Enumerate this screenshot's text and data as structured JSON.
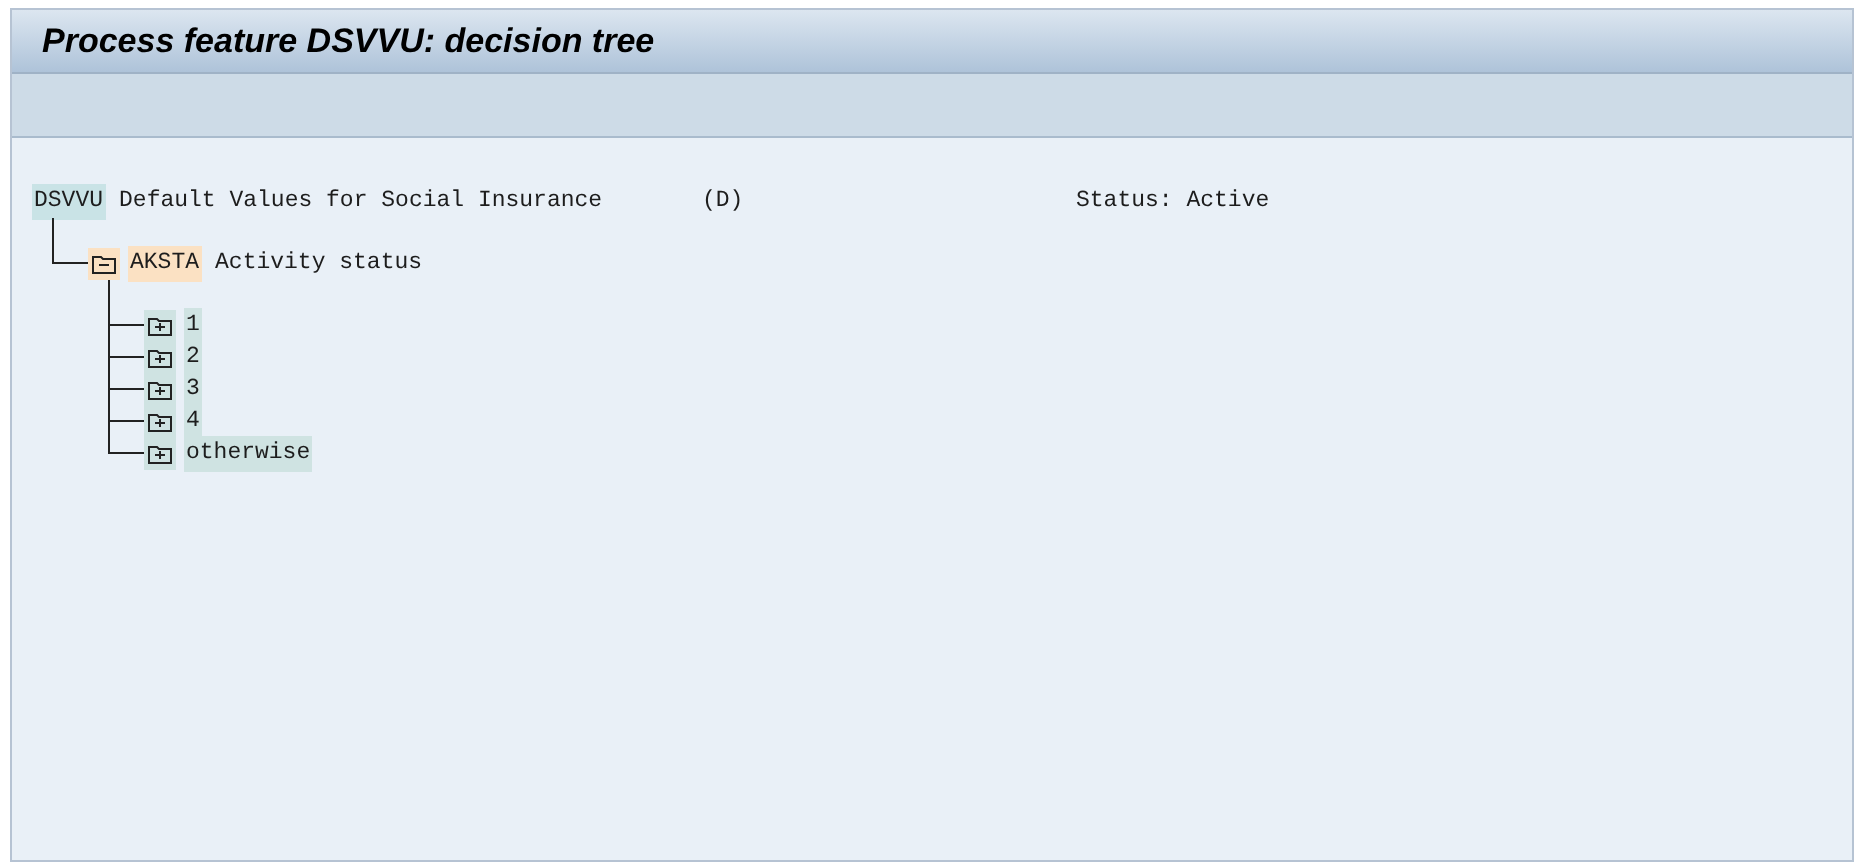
{
  "window": {
    "title": "Process feature DSVVU: decision tree"
  },
  "tree": {
    "kind": "feature",
    "key": "DSVVU",
    "text": "Default Values for Social Insurance",
    "language": "(D)",
    "status": "Status: Active",
    "children": [
      {
        "kind": "field",
        "key": "AKSTA",
        "text": "Activity status",
        "expanded": true,
        "children": [
          {
            "kind": "value",
            "key": "1",
            "expanded": false
          },
          {
            "kind": "value",
            "key": "2",
            "expanded": false
          },
          {
            "kind": "value",
            "key": "3",
            "expanded": false
          },
          {
            "kind": "value",
            "key": "4",
            "expanded": false
          },
          {
            "kind": "value",
            "key": "otherwise",
            "expanded": false
          }
        ]
      }
    ]
  }
}
